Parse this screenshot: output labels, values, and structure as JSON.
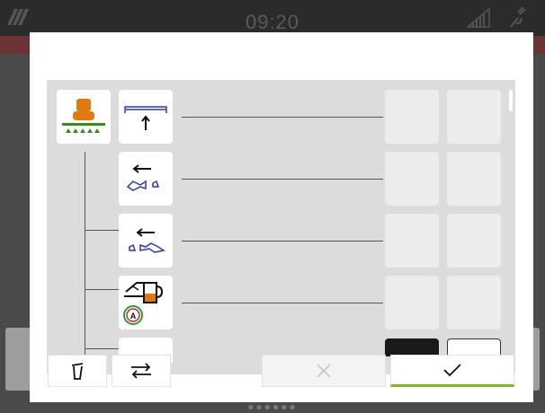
{
  "statusbar": {
    "time": "09:20",
    "logo_icon": "amazone-logo-icon",
    "signal_icon": "signal-strength-icon",
    "gps_icon": "gps-satellite-icon"
  },
  "dialog": {
    "rows": [
      {
        "name": "boom-height-row",
        "icon": "boom-raise-icon"
      },
      {
        "name": "fold-left-row",
        "icon": "boom-fold-left-icon"
      },
      {
        "name": "fold-right-row",
        "icon": "boom-fold-right-icon"
      },
      {
        "name": "tank-auto-row",
        "icon": "tank-level-auto-icon"
      }
    ],
    "root_icon": "sprayer-machine-icon",
    "auto_badge": "A"
  },
  "toolbar": {
    "delete_icon": "trash-icon",
    "swap_icon": "swap-arrows-icon",
    "cancel_icon": "close-icon",
    "confirm_icon": "check-icon"
  },
  "colors": {
    "accent_green": "#7fb92a",
    "icon_blue": "#2b3aa8",
    "tank_orange": "#e07a10",
    "list_gray": "#dcdcdc"
  }
}
